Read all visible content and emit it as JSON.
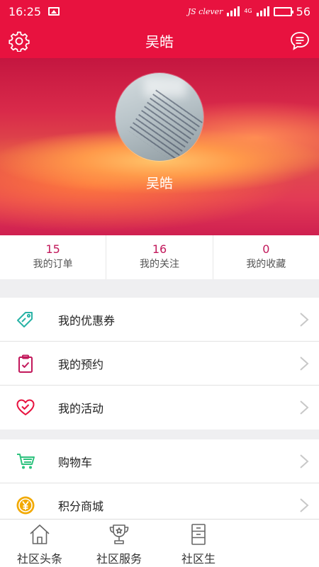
{
  "status_bar": {
    "time": "16:25",
    "carrier": "JS clever",
    "network": "4G",
    "battery": "56",
    "battery_level": 0.56
  },
  "header": {
    "title": "吴皓"
  },
  "profile": {
    "name": "吴皓"
  },
  "stats": [
    {
      "value": "15",
      "label": "我的订单"
    },
    {
      "value": "16",
      "label": "我的关注"
    },
    {
      "value": "0",
      "label": "我的收藏"
    }
  ],
  "menu_group_1": [
    {
      "label": "我的优惠券",
      "icon": "coupon-tag-icon",
      "color": "#2ab3a6"
    },
    {
      "label": "我的预约",
      "icon": "clipboard-check-icon",
      "color": "#c2185b"
    },
    {
      "label": "我的活动",
      "icon": "heart-check-icon",
      "color": "#e8123f"
    }
  ],
  "menu_group_2": [
    {
      "label": "购物车",
      "icon": "shopping-cart-icon",
      "color": "#2ec27e"
    },
    {
      "label": "积分商城",
      "icon": "yen-coin-icon",
      "color": "#f2a900"
    }
  ],
  "tabs": [
    {
      "label": "社区头条",
      "icon": "house-icon"
    },
    {
      "label": "社区服务",
      "icon": "trophy-icon"
    },
    {
      "label": "社区生",
      "icon": "cabinet-icon"
    }
  ],
  "colors": {
    "brand": "#e8123f",
    "stat_number": "#c2185b"
  }
}
